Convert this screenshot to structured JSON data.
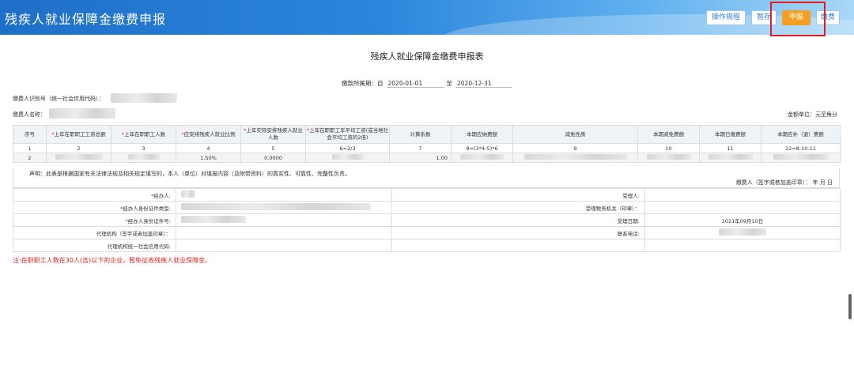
{
  "header": {
    "title": "残疾人就业保障金缴费申报",
    "buttons": [
      "操作规程",
      "暂存",
      "申报",
      "缴费"
    ]
  },
  "form": {
    "title": "残疾人就业保障金缴费申报表",
    "period_label": "缴款所属期：自",
    "period_from": "2020-01-01",
    "period_to_label": "至",
    "period_to": "2020-12-31",
    "taxpayer_id_label": "缴费人识别号（统一社会信用代码）：",
    "taxpayer_name_label": "缴费人名称：",
    "unit_label": "金额单位：元至角分"
  },
  "table": {
    "headers": [
      {
        "req": "",
        "text": "序号"
      },
      {
        "req": "*",
        "text": "上年在职职工工资总额"
      },
      {
        "req": "*",
        "text": "上年在职职工人数"
      },
      {
        "req": "*",
        "text": "应安排残疾人就业比例"
      },
      {
        "req": "*",
        "text": "上年实际安排残疾人就业人数"
      },
      {
        "req": "*",
        "text": "上年在职职工年平均工资(或当地社会平均工资的2倍)"
      },
      {
        "req": "",
        "text": "计算系数"
      },
      {
        "req": "",
        "text": "本期应纳费额"
      },
      {
        "req": "",
        "text": "减免性质"
      },
      {
        "req": "",
        "text": "本期减免费额"
      },
      {
        "req": "",
        "text": "本期已缴费额"
      },
      {
        "req": "",
        "text": "本期应补（退）费额"
      }
    ],
    "index_row": [
      "1",
      "2",
      "3",
      "4",
      "5",
      "6=2/3",
      "7",
      "8=(3*4-5)*6",
      "9",
      "10",
      "11",
      "12=8-10-11"
    ],
    "data_row": {
      "seq": "2",
      "ratio": "1.50%",
      "actual": "0.0000",
      "coef": "1.00"
    }
  },
  "declaration": {
    "text": "声明：此表是根据国家有关法律法规及相关规定填写的，本人（单位）对填报内容（及附带资料）的真实性、可靠性、完整性负责。",
    "sign": "缴费人（签字或者加盖印章）：      年    月    日"
  },
  "sub": {
    "agent_label": "经办人:",
    "agent_id_type_label": "经办人身份证件类型:",
    "agent_id_no_label": "经办人身份证件号:",
    "agency_label": "代理机构（签字或者加盖印章）：",
    "agency_code_label": "代理机构统一社会信用代码:",
    "accept_person_label": "受理人:",
    "accept_org_label": "受理税务机关（印章）：",
    "accept_date_label": "受理日期:",
    "accept_date": "2021年09月10日",
    "phone_label": "联系电话:"
  },
  "note": "注:在职职工人数在30人(含)以下的企业，暂免征收残疾人就业保障金。"
}
